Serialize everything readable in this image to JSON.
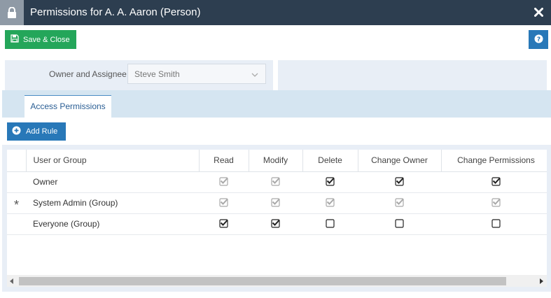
{
  "window": {
    "title": "Permissions for A. A. Aaron (Person)",
    "title_icon": "lock-icon",
    "close_icon": "close-icon"
  },
  "toolbar": {
    "save_label": "Save & Close",
    "save_icon": "floppy-disk-icon",
    "help_icon": "question-circle-icon"
  },
  "owner": {
    "label": "Owner and Assignee",
    "value": "Steve Smith"
  },
  "tabs": [
    {
      "label": "Access Permissions",
      "active": true
    }
  ],
  "add_rule": {
    "label": "Add Rule",
    "icon": "plus-circle-icon"
  },
  "grid": {
    "columns": [
      "User or Group",
      "Read",
      "Modify",
      "Delete",
      "Change Owner",
      "Change Permissions"
    ],
    "rows": [
      {
        "marker": "",
        "name": "Owner",
        "cells": [
          {
            "checked": true,
            "disabled": true
          },
          {
            "checked": true,
            "disabled": true
          },
          {
            "checked": true,
            "disabled": false
          },
          {
            "checked": true,
            "disabled": false
          },
          {
            "checked": true,
            "disabled": false
          }
        ]
      },
      {
        "marker": "*",
        "name": "System Admin (Group)",
        "cells": [
          {
            "checked": true,
            "disabled": true
          },
          {
            "checked": true,
            "disabled": true
          },
          {
            "checked": true,
            "disabled": true
          },
          {
            "checked": true,
            "disabled": true
          },
          {
            "checked": true,
            "disabled": true
          }
        ]
      },
      {
        "marker": "",
        "name": "Everyone (Group)",
        "cells": [
          {
            "checked": true,
            "disabled": false
          },
          {
            "checked": true,
            "disabled": false
          },
          {
            "checked": false,
            "disabled": false
          },
          {
            "checked": false,
            "disabled": false
          },
          {
            "checked": false,
            "disabled": false
          }
        ]
      }
    ]
  },
  "colors": {
    "titlebar": "#2d3e50",
    "save": "#24a65a",
    "accent": "#2878b8",
    "panel": "#e8eef6",
    "tab_strip": "#d5e5f1"
  }
}
